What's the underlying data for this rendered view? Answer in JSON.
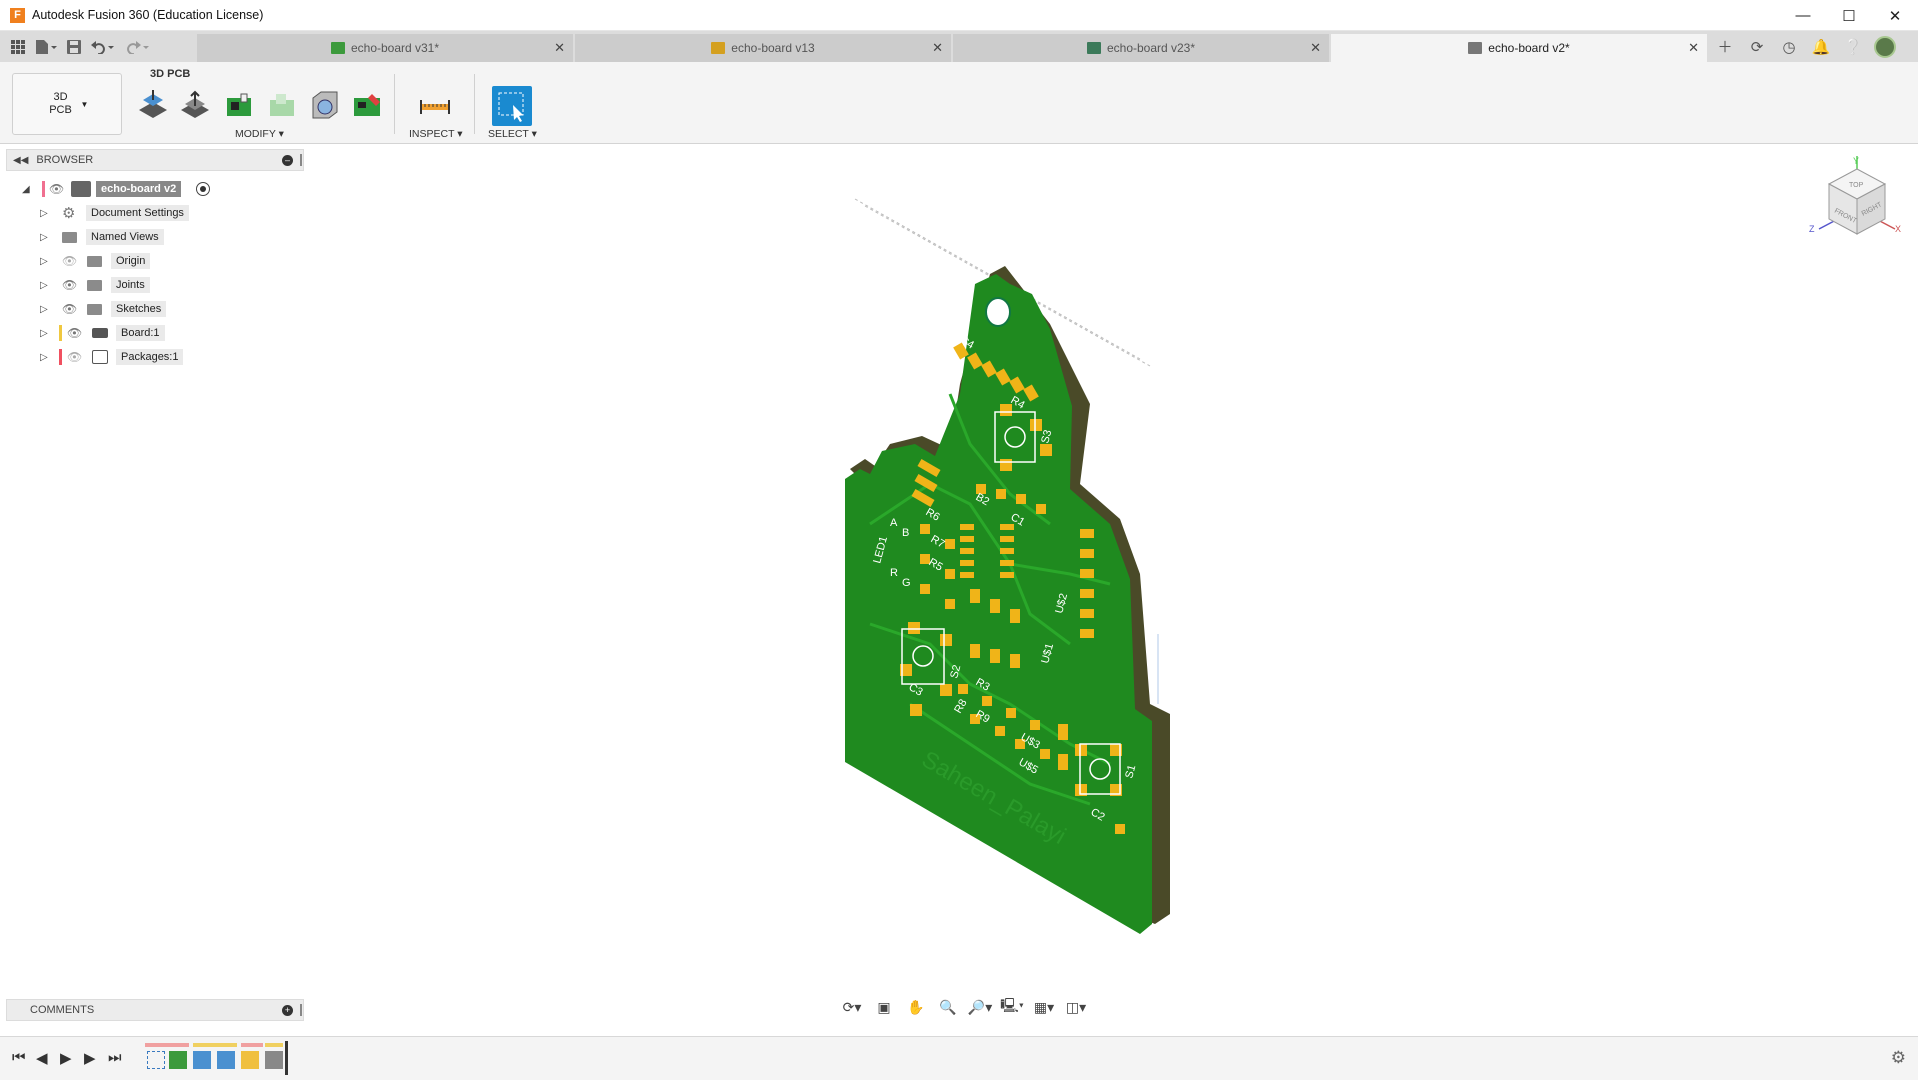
{
  "window": {
    "title": "Autodesk Fusion 360 (Education License)",
    "logo_letter": "F",
    "controls": [
      "minimize-icon",
      "maximize-icon",
      "close-icon"
    ]
  },
  "quick_access": [
    "grid-icon",
    "file-icon",
    "save-icon",
    "undo-icon",
    "redo-icon"
  ],
  "tabs": [
    {
      "label": "echo-board v31*",
      "icon_color": "#3c9a3c",
      "active": false
    },
    {
      "label": "echo-board v13",
      "icon_color": "#d4a020",
      "active": false
    },
    {
      "label": "echo-board v23*",
      "icon_color": "#3c7a5a",
      "active": false
    },
    {
      "label": "echo-board v2*",
      "icon_color": "#777777",
      "active": true
    }
  ],
  "tab_tools": [
    "add-tab-icon",
    "sync-icon",
    "clock-icon",
    "bell-icon",
    "help-icon",
    "avatar"
  ],
  "toolbar": {
    "workspace": "3D\nPCB",
    "workspace_line1": "3D",
    "workspace_line2": "PCB",
    "tab_label": "3D PCB",
    "groups": {
      "modify": "MODIFY",
      "inspect": "INSPECT",
      "select": "SELECT"
    }
  },
  "browser": {
    "title": "BROWSER",
    "root": "echo-board v2",
    "items": [
      {
        "label": "Document Settings",
        "icon": "gear-icon"
      },
      {
        "label": "Named Views",
        "icon": "folder-icon"
      },
      {
        "label": "Origin",
        "icon": "folder-icon"
      },
      {
        "label": "Joints",
        "icon": "folder-icon"
      },
      {
        "label": "Sketches",
        "icon": "folder-icon"
      },
      {
        "label": "Board:1",
        "icon": "layers-icon"
      },
      {
        "label": "Packages:1",
        "icon": "component-icon"
      }
    ]
  },
  "comments": {
    "title": "COMMENTS"
  },
  "viewcube": {
    "top": "TOP",
    "front": "FRONT",
    "right": "RIGHT",
    "x": "X",
    "y": "Y",
    "z": "Z"
  },
  "pcb": {
    "board_color": "#1f8a1f",
    "pad_color": "#f0b418",
    "edge_color": "#4a4a28",
    "labels": {
      "u4": "U$4",
      "r4": "R4",
      "s3": "S3",
      "r6": "R6",
      "r7": "R7",
      "r5": "R5",
      "led1": "LED1",
      "a": "A",
      "b": "B",
      "r": "R",
      "g": "G",
      "c1": "C1",
      "u2": "U$2",
      "u1": "U$1",
      "s2": "S2",
      "r3": "R3",
      "r8": "R8",
      "r9": "R9",
      "u3": "U$3",
      "u5": "U$5",
      "s1": "S1",
      "c2": "C2",
      "c3": "C3",
      "b2": "B2",
      "silk": "Saheen_Palayi"
    }
  }
}
